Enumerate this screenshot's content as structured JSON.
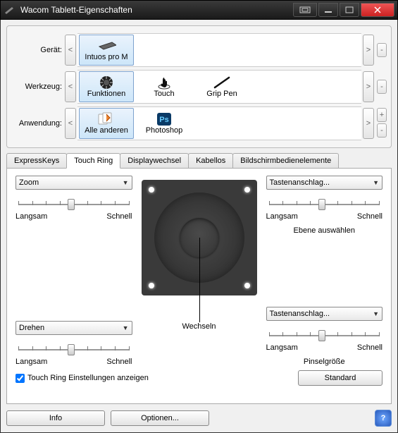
{
  "window": {
    "title": "Wacom Tablett-Eigenschaften"
  },
  "selectors": {
    "device_label": "Gerät:",
    "tool_label": "Werkzeug:",
    "app_label": "Anwendung:",
    "devices": [
      {
        "label": "Intuos pro M"
      }
    ],
    "tools": [
      {
        "label": "Funktionen"
      },
      {
        "label": "Touch"
      },
      {
        "label": "Grip Pen"
      }
    ],
    "apps": [
      {
        "label": "Alle anderen"
      },
      {
        "label": "Photoshop"
      }
    ]
  },
  "tabs": {
    "items": [
      "ExpressKeys",
      "Touch Ring",
      "Displaywechsel",
      "Kabellos",
      "Bildschirmbedienelemente"
    ],
    "active": 1
  },
  "ring": {
    "tl": {
      "mode": "Zoom",
      "slow": "Langsam",
      "fast": "Schnell",
      "extra": ""
    },
    "tr": {
      "mode": "Tastenanschlag...",
      "slow": "Langsam",
      "fast": "Schnell",
      "extra": "Ebene auswählen"
    },
    "bl": {
      "mode": "Drehen",
      "slow": "Langsam",
      "fast": "Schnell",
      "extra": ""
    },
    "br": {
      "mode": "Tastenanschlag...",
      "slow": "Langsam",
      "fast": "Schnell",
      "extra": "Pinselgröße"
    },
    "center_label": "Wechseln"
  },
  "show_settings_label": "Touch Ring Einstellungen anzeigen",
  "buttons": {
    "standard": "Standard",
    "info": "Info",
    "options": "Optionen..."
  }
}
